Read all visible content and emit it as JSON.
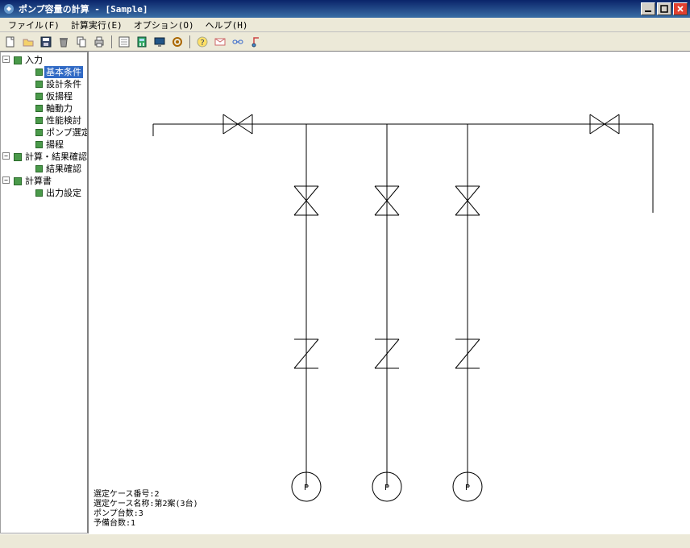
{
  "titlebar": {
    "title": "ポンプ容量の計算 - [Sample]"
  },
  "menu": {
    "file": "ファイル(F)",
    "calc": "計算実行(E)",
    "option": "オプション(O)",
    "help": "ヘルプ(H)"
  },
  "tree": {
    "root1": "入力",
    "items1": {
      "a": "基本条件",
      "b": "設計条件",
      "c": "仮揚程",
      "d": "軸動力",
      "e": "性能検討",
      "f": "ポンプ選定",
      "g": "揚程"
    },
    "root2": "計算・結果確認",
    "items2": {
      "a": "結果確認"
    },
    "root3": "計算書",
    "items3": {
      "a": "出力設定"
    }
  },
  "diagram_footer": {
    "l1": "選定ケース番号:2",
    "l2": "選定ケース名称:第2案(3台)",
    "l3": "ポンプ台数:3",
    "l4": "予備台数:1"
  }
}
